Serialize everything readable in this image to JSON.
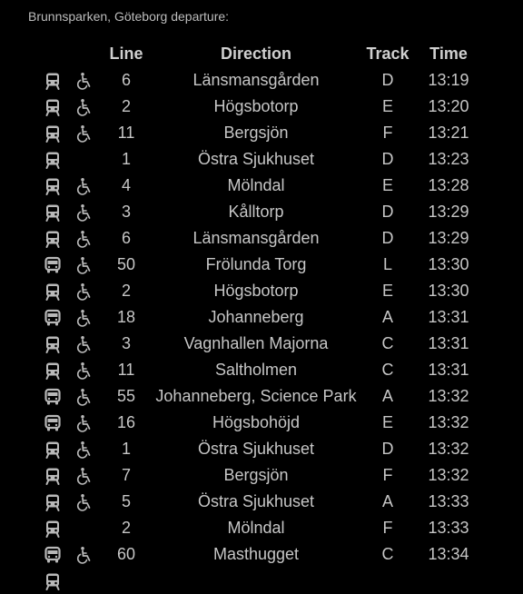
{
  "header": {
    "title": "Brunnsparken, Göteborg departure:"
  },
  "columns": {
    "line": "Line",
    "direction": "Direction",
    "track": "Track",
    "time": "Time"
  },
  "colors": {
    "background": "#000000",
    "text": "#c6c6c6",
    "icon": "#b8b8b8"
  },
  "departures": [
    {
      "type_icon": "tram-icon",
      "accessible": true,
      "line": "6",
      "direction": "Länsmansgården",
      "track": "D",
      "time": "13:19"
    },
    {
      "type_icon": "tram-icon",
      "accessible": true,
      "line": "2",
      "direction": "Högsbotorp",
      "track": "E",
      "time": "13:20"
    },
    {
      "type_icon": "tram-icon",
      "accessible": true,
      "line": "11",
      "direction": "Bergsjön",
      "track": "F",
      "time": "13:21"
    },
    {
      "type_icon": "tram-icon",
      "accessible": false,
      "line": "1",
      "direction": "Östra Sjukhuset",
      "track": "D",
      "time": "13:23"
    },
    {
      "type_icon": "tram-icon",
      "accessible": true,
      "line": "4",
      "direction": "Mölndal",
      "track": "E",
      "time": "13:28"
    },
    {
      "type_icon": "tram-icon",
      "accessible": true,
      "line": "3",
      "direction": "Kålltorp",
      "track": "D",
      "time": "13:29"
    },
    {
      "type_icon": "tram-icon",
      "accessible": true,
      "line": "6",
      "direction": "Länsmansgården",
      "track": "D",
      "time": "13:29"
    },
    {
      "type_icon": "bus-icon",
      "accessible": true,
      "line": "50",
      "direction": "Frölunda Torg",
      "track": "L",
      "time": "13:30"
    },
    {
      "type_icon": "tram-icon",
      "accessible": true,
      "line": "2",
      "direction": "Högsbotorp",
      "track": "E",
      "time": "13:30"
    },
    {
      "type_icon": "bus-icon",
      "accessible": true,
      "line": "18",
      "direction": "Johanneberg",
      "track": "A",
      "time": "13:31"
    },
    {
      "type_icon": "tram-icon",
      "accessible": true,
      "line": "3",
      "direction": "Vagnhallen Majorna",
      "track": "C",
      "time": "13:31"
    },
    {
      "type_icon": "tram-icon",
      "accessible": true,
      "line": "11",
      "direction": "Saltholmen",
      "track": "C",
      "time": "13:31"
    },
    {
      "type_icon": "bus-icon",
      "accessible": true,
      "line": "55",
      "direction": "Johanneberg, Science Park",
      "track": "A",
      "time": "13:32"
    },
    {
      "type_icon": "bus-icon",
      "accessible": true,
      "line": "16",
      "direction": "Högsbohöjd",
      "track": "E",
      "time": "13:32"
    },
    {
      "type_icon": "tram-icon",
      "accessible": true,
      "line": "1",
      "direction": "Östra Sjukhuset",
      "track": "D",
      "time": "13:32"
    },
    {
      "type_icon": "tram-icon",
      "accessible": true,
      "line": "7",
      "direction": "Bergsjön",
      "track": "F",
      "time": "13:32"
    },
    {
      "type_icon": "tram-icon",
      "accessible": true,
      "line": "5",
      "direction": "Östra Sjukhuset",
      "track": "A",
      "time": "13:33"
    },
    {
      "type_icon": "tram-icon",
      "accessible": false,
      "line": "2",
      "direction": "Mölndal",
      "track": "F",
      "time": "13:33"
    },
    {
      "type_icon": "bus-icon",
      "accessible": true,
      "line": "60",
      "direction": "Masthugget",
      "track": "C",
      "time": "13:34"
    },
    {
      "type_icon": "tram-icon",
      "accessible": false,
      "line": "",
      "direction": "",
      "track": "",
      "time": ""
    }
  ]
}
